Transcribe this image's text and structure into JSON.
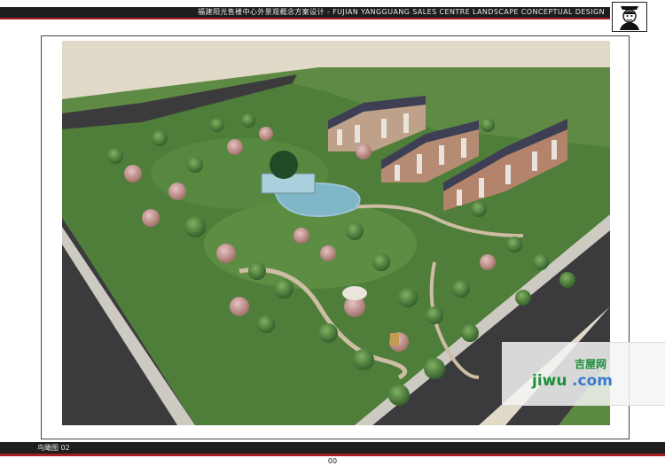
{
  "header": {
    "title": "福建阳光售楼中心外景观概念方案设计 - FUJIAN YANGGUANG SALES CENTRE  LANDSCAPE CONCEPTUAL DESIGN"
  },
  "watermark": {
    "brand": "jiwu",
    "domain": ".com",
    "name_cn": "吉屋网"
  },
  "footer": {
    "label": "鸟瞰图 02",
    "page_number": "00"
  },
  "colors": {
    "header_bar": "#1e1e1e",
    "accent_red": "#a61e24",
    "lawn": "#4f7d3a",
    "road": "#3b3b3d",
    "sidewalk": "#cdcac1",
    "water": "#7fb7c9"
  }
}
